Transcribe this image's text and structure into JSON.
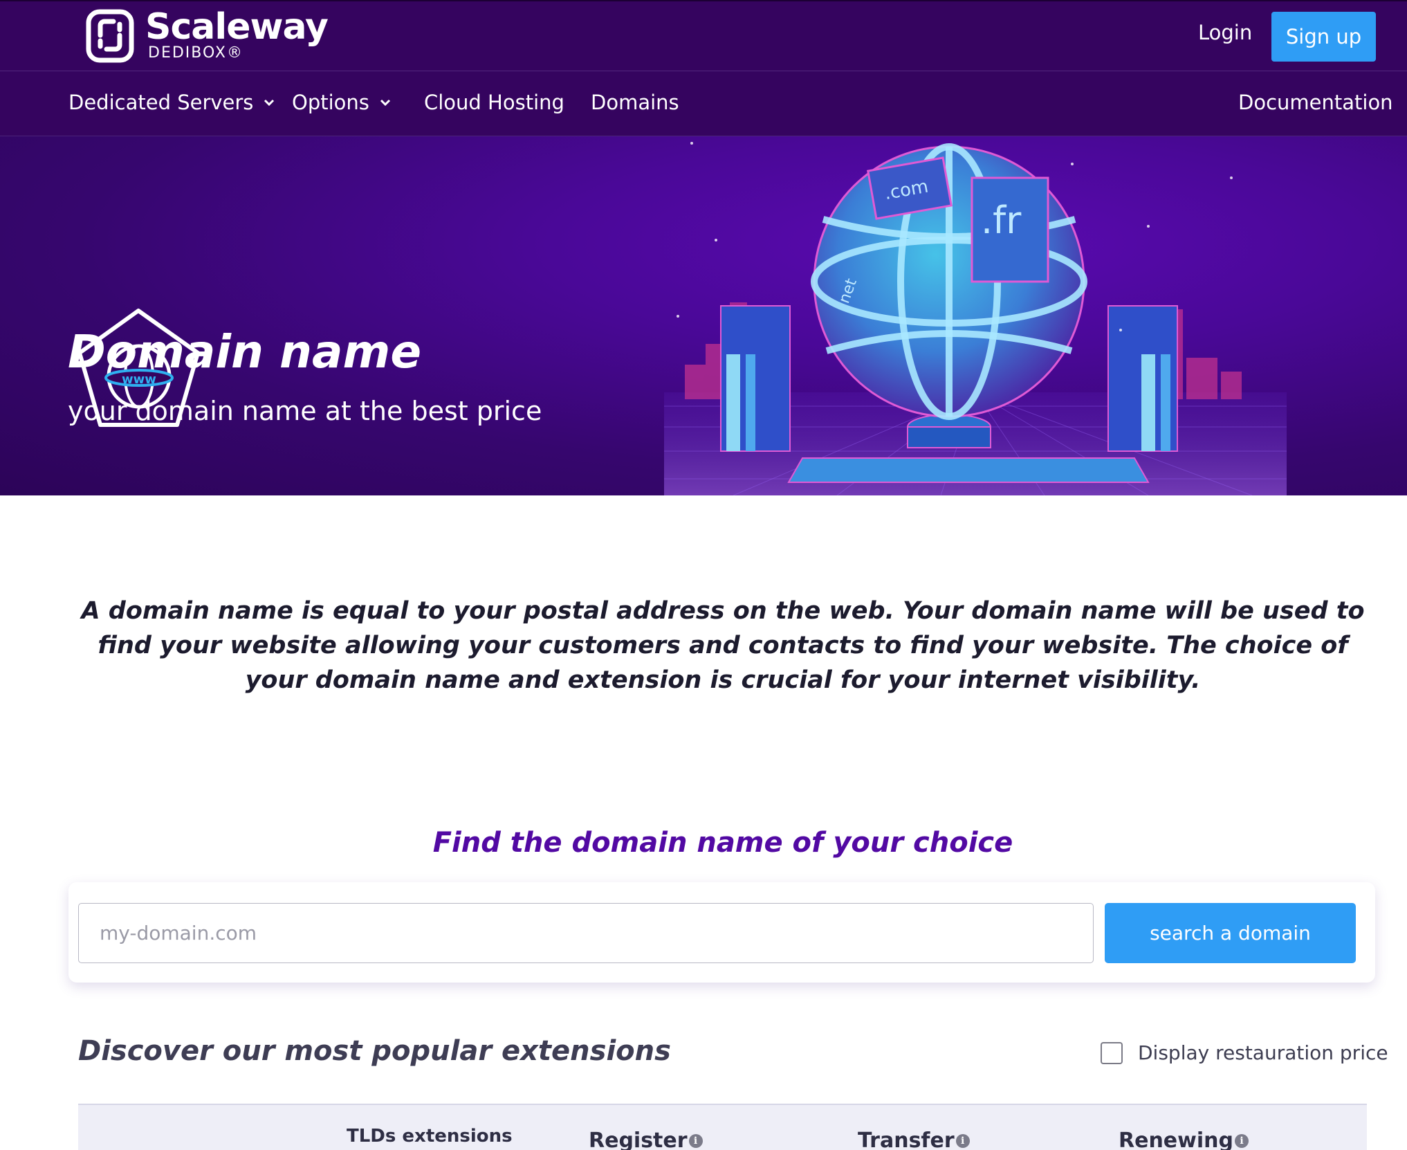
{
  "brand": {
    "name": "Scaleway",
    "sub": "DEDIBOX®"
  },
  "header": {
    "login_label": "Login",
    "signup_label": "Sign up"
  },
  "nav": {
    "items": [
      {
        "label": "Dedicated Servers",
        "has_dropdown": true
      },
      {
        "label": "Options",
        "has_dropdown": true
      },
      {
        "label": "Cloud Hosting",
        "has_dropdown": false
      },
      {
        "label": "Domains",
        "has_dropdown": false
      }
    ],
    "documentation_label": "Documentation"
  },
  "hero": {
    "title": "Domain name",
    "subtitle": "your domain name at the best price",
    "icon": "www-globe-icon",
    "art_labels": [
      ".com",
      ".fr",
      "net"
    ]
  },
  "intro": {
    "text": "A domain name is equal to your postal address on the web. Your domain name will be used to find your website allowing your customers and contacts to find your website. The choice of your domain name and extension is crucial for your internet visibility."
  },
  "search": {
    "title": "Find the domain name of your choice",
    "placeholder": "my-domain.com",
    "value": "",
    "button_label": "search a domain"
  },
  "extensions": {
    "title": "Discover our most popular extensions",
    "restore_label": "Display restauration price",
    "restore_checked": false,
    "columns": [
      "TLDs extensions",
      "Register",
      "Transfer",
      "Renewing"
    ]
  },
  "colors": {
    "header_bg": "#35045f",
    "accent_blue": "#2f9df5",
    "find_title": "#5209a3"
  }
}
